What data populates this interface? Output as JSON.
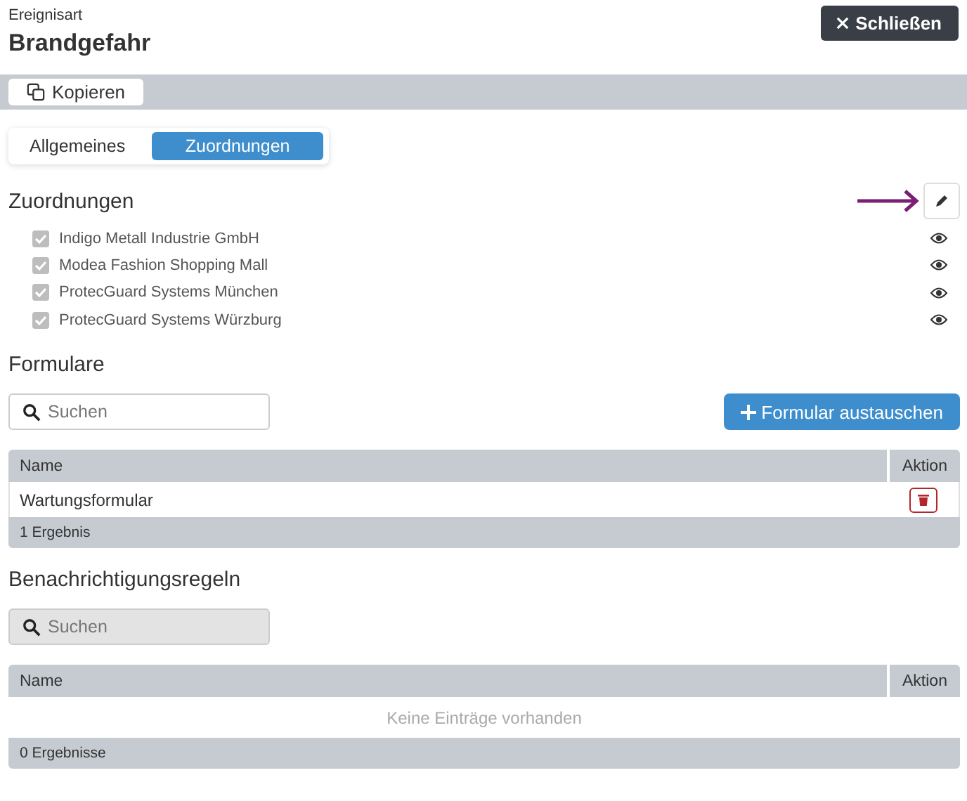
{
  "header": {
    "subtitle": "Ereignisart",
    "title": "Brandgefahr",
    "close_button": "Schließen"
  },
  "toolbar": {
    "copy_button": "Kopieren"
  },
  "tabs": [
    {
      "label": "Allgemeines",
      "selected": false
    },
    {
      "label": "Zuordnungen",
      "selected": true
    }
  ],
  "assignments": {
    "heading": "Zuordnungen",
    "items": [
      {
        "label": "Indigo Metall Industrie GmbH",
        "checked": true,
        "disabled": true
      },
      {
        "label": "Modea Fashion Shopping Mall",
        "checked": true,
        "disabled": true
      },
      {
        "label": "ProtecGuard Systems München",
        "checked": true,
        "disabled": true
      },
      {
        "label": "ProtecGuard Systems Würzburg",
        "checked": true,
        "disabled": true
      }
    ]
  },
  "forms": {
    "heading": "Formulare",
    "search": {
      "placeholder": "Suchen",
      "disabled": false
    },
    "add_button": "Formular austauschen",
    "columns": [
      "Name",
      "Aktion"
    ],
    "rows": [
      {
        "name": "Wartungsformular"
      }
    ],
    "footer": "1 Ergebnis"
  },
  "rules": {
    "heading": "Benachrichtigungsregeln",
    "search": {
      "placeholder": "Suchen",
      "disabled": true
    },
    "columns": [
      "Name",
      "Aktion"
    ],
    "empty": "Keine Einträge vorhanden",
    "footer": "0 Ergebnisse"
  }
}
